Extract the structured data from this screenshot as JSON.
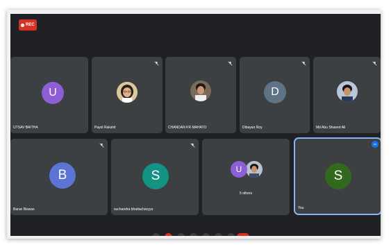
{
  "recording": {
    "label": "REC",
    "color": "#d93025"
  },
  "tiles": [
    {
      "name": "UTSAV BAITHA",
      "initial": "U",
      "avatar_color": "#8e5ed5",
      "type": "initial"
    },
    {
      "name": "Payel Rakshit",
      "type": "photo"
    },
    {
      "name": "CHANDAN KR MAHATO",
      "type": "photo"
    },
    {
      "name": "Dibayan Roy",
      "initial": "D",
      "avatar_color": "#5f7386",
      "type": "initial"
    },
    {
      "name": "Md Abu Shaeed Ali",
      "type": "photo"
    },
    {
      "name": "Barun Biswas",
      "initial": "B",
      "avatar_color": "#5b74d6",
      "type": "initial"
    },
    {
      "name": "suchandra bhattacharyya",
      "initial": "S",
      "avatar_color": "#139383",
      "type": "initial"
    },
    {
      "name": "5 others",
      "initial": "U",
      "avatar_color": "#8e5ed5",
      "type": "group"
    },
    {
      "name": "You",
      "initial": "S",
      "avatar_color": "#33691e",
      "type": "initial",
      "self": true
    }
  ],
  "icons": {
    "mic_off": "mic-off-icon",
    "pin": "pin-icon"
  },
  "colors": {
    "background": "#202124",
    "tile": "#3c4043",
    "self_outline": "#8ab4f8"
  }
}
